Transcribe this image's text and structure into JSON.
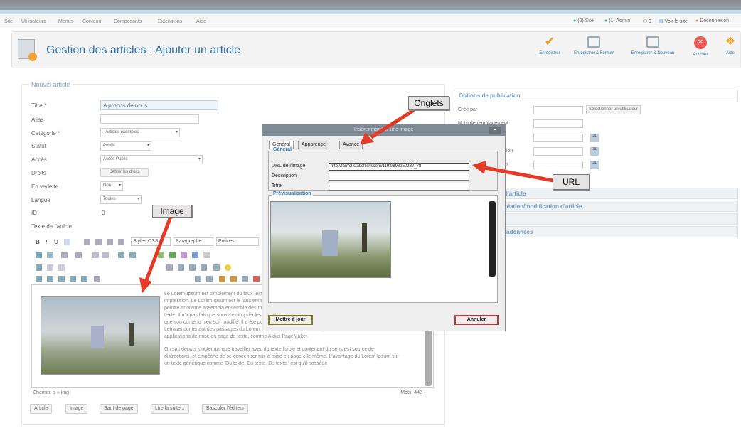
{
  "menu": {
    "items": [
      "Site",
      "Utilisateurs",
      "Menus",
      "Contenu",
      "Composants",
      "Extensions",
      "Aide"
    ]
  },
  "status": {
    "site": "(0) Site",
    "admin": "(1) Admin",
    "messages": "0",
    "view_site": "Voir le site",
    "logout": "Déconnexion"
  },
  "header": {
    "title": "Gestion des articles : Ajouter un article"
  },
  "toolbar": {
    "buttons": [
      "Enregistrer",
      "Enregistrer & Fermer",
      "Enregistrer & Nouveau",
      "Annuler",
      "Aide"
    ]
  },
  "article": {
    "legend": "Nouvel article",
    "fields": [
      {
        "label": "Titre",
        "value": "A propos de nous"
      },
      {
        "label": "Alias",
        "value": ""
      },
      {
        "label": "Catégorie",
        "value": "- Articles exemples"
      },
      {
        "label": "Statut",
        "value": "Publié"
      },
      {
        "label": "Accès",
        "value": "Accès Public"
      },
      {
        "label": "Droits",
        "value": "Définir les droits"
      },
      {
        "label": "En vedette",
        "value": "Non"
      },
      {
        "label": "Langue",
        "value": "Toutes"
      },
      {
        "label": "ID",
        "value": "0"
      }
    ],
    "text_label": "Texte de l'article"
  },
  "editor": {
    "styles": "Styles CSS",
    "paragraph": "Paragraphe",
    "fonts": "Polices",
    "path": "Chemin: p » img",
    "words": "Mots: 443",
    "text1": "Le Lorem Ipsum est simplement du faux texte employé dans la composition et la mise en page avant impression. Le Lorem Ipsum est le faux texte standard de l'imprimerie depuis les années 1500, quand un peintre anonyme assembla ensemble des morceaux de texte pour réaliser un livre spécimen de polices de texte. Il n'a pas fait que survivre cinq siècles, mais s'est aussi adapté à la bureautique informatique, sans que son contenu n'en soit modifié. Il a été popularisé dans les années 1960 grâce à la vente de feuilles Letraset contenant des passages du Lorem Ipsum, et, plus récemment, par son inclusion dans des applications de mise en page de texte, comme Aldus PageMaker.",
    "text2": "On sait depuis longtemps que travailler avec du texte lisible et contenant du sens est source de distractions, et empêche de se concentrer sur la mise en page elle-même. L'avantage du Lorem Ipsum sur un texte générique comme 'Du texte. Du texte. Du texte.' est qu'il possède",
    "buttons": [
      "Article",
      "Image",
      "Saut de page",
      "Lire la suite...",
      "Basculer l'éditeur"
    ]
  },
  "publish": {
    "legend": "Options de publication",
    "created_by": "Créé par",
    "select_user": "Sélectionner un utilisateur",
    "alias_label": "Nom de remplacement",
    "label_partial_1": "tion",
    "label_partial_2": "n",
    "accordions": [
      "Options de l'article",
      "Options de création/modification d'article",
      "Métadonnées"
    ],
    "accordion_partials": [
      "e l'article",
      "création/modification d'article",
      "s",
      "étadonnées"
    ]
  },
  "dialog": {
    "title": "Insérer/modifier une image",
    "tabs": [
      "Général",
      "Apparence",
      "Avancé"
    ],
    "general_legend": "Général",
    "url_label": "URL de l'image",
    "url_value": "http://farm2.staticflickr.com/1198/898250237_78",
    "desc_label": "Description",
    "title_label": "Titre",
    "preview_legend": "Prévisualisation",
    "update": "Mettre à jour",
    "cancel": "Annuler"
  },
  "callouts": {
    "tabs": "Onglets",
    "url": "URL",
    "image": "Image"
  }
}
